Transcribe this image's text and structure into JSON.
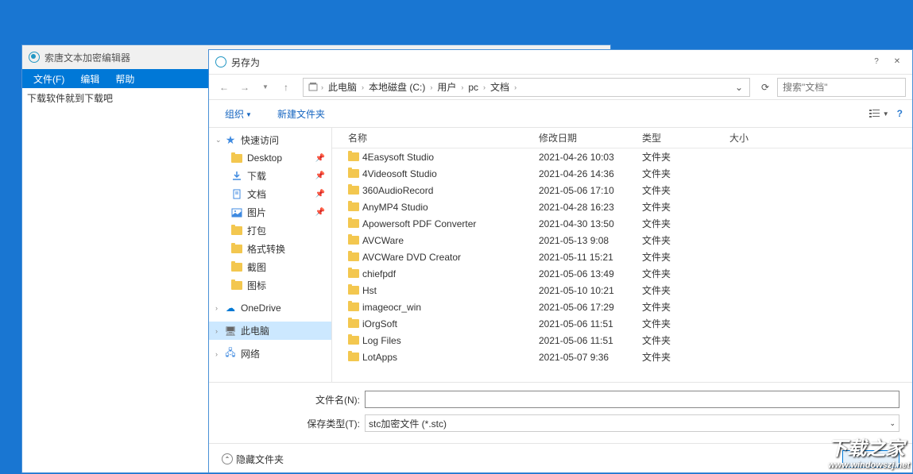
{
  "editor": {
    "title": "索唐文本加密编辑器",
    "menu": {
      "file": "文件(F)",
      "edit": "编辑",
      "help": "帮助"
    },
    "content": "下载软件就到下载吧"
  },
  "dialog": {
    "title": "另存为",
    "breadcrumb": [
      "此电脑",
      "本地磁盘 (C:)",
      "用户",
      "pc",
      "文档"
    ],
    "search_placeholder": "搜索\"文档\"",
    "toolbar": {
      "organize": "组织",
      "newfolder": "新建文件夹"
    },
    "nav": {
      "quick_access": "快速访问",
      "items": [
        {
          "label": "Desktop",
          "icon": "folder",
          "pinned": true
        },
        {
          "label": "下载",
          "icon": "downloads",
          "pinned": true
        },
        {
          "label": "文档",
          "icon": "documents",
          "pinned": true
        },
        {
          "label": "图片",
          "icon": "pictures",
          "pinned": true
        },
        {
          "label": "打包",
          "icon": "folder",
          "pinned": false
        },
        {
          "label": "格式转换",
          "icon": "folder",
          "pinned": false
        },
        {
          "label": "截图",
          "icon": "folder",
          "pinned": false
        },
        {
          "label": "图标",
          "icon": "folder",
          "pinned": false
        }
      ],
      "onedrive": "OneDrive",
      "this_pc": "此电脑",
      "network": "网络"
    },
    "columns": {
      "name": "名称",
      "date": "修改日期",
      "type": "类型",
      "size": "大小"
    },
    "files": [
      {
        "name": "4Easysoft Studio",
        "date": "2021-04-26 10:03",
        "type": "文件夹"
      },
      {
        "name": "4Videosoft Studio",
        "date": "2021-04-26 14:36",
        "type": "文件夹"
      },
      {
        "name": "360AudioRecord",
        "date": "2021-05-06 17:10",
        "type": "文件夹"
      },
      {
        "name": "AnyMP4 Studio",
        "date": "2021-04-28 16:23",
        "type": "文件夹"
      },
      {
        "name": "Apowersoft PDF Converter",
        "date": "2021-04-30 13:50",
        "type": "文件夹"
      },
      {
        "name": "AVCWare",
        "date": "2021-05-13 9:08",
        "type": "文件夹"
      },
      {
        "name": "AVCWare DVD Creator",
        "date": "2021-05-11 15:21",
        "type": "文件夹"
      },
      {
        "name": "chiefpdf",
        "date": "2021-05-06 13:49",
        "type": "文件夹"
      },
      {
        "name": "Hst",
        "date": "2021-05-10 10:21",
        "type": "文件夹"
      },
      {
        "name": "imageocr_win",
        "date": "2021-05-06 17:29",
        "type": "文件夹"
      },
      {
        "name": "iOrgSoft",
        "date": "2021-05-06 11:51",
        "type": "文件夹"
      },
      {
        "name": "Log Files",
        "date": "2021-05-06 11:51",
        "type": "文件夹"
      },
      {
        "name": "LotApps",
        "date": "2021-05-07 9:36",
        "type": "文件夹"
      }
    ],
    "filename_label": "文件名(N):",
    "savetype_label": "保存类型(T):",
    "savetype_value": "stc加密文件 (*.stc)",
    "hide_folders": "隐藏文件夹"
  },
  "watermark": {
    "main": "下载之家",
    "sub": "www.windowszj.net"
  }
}
